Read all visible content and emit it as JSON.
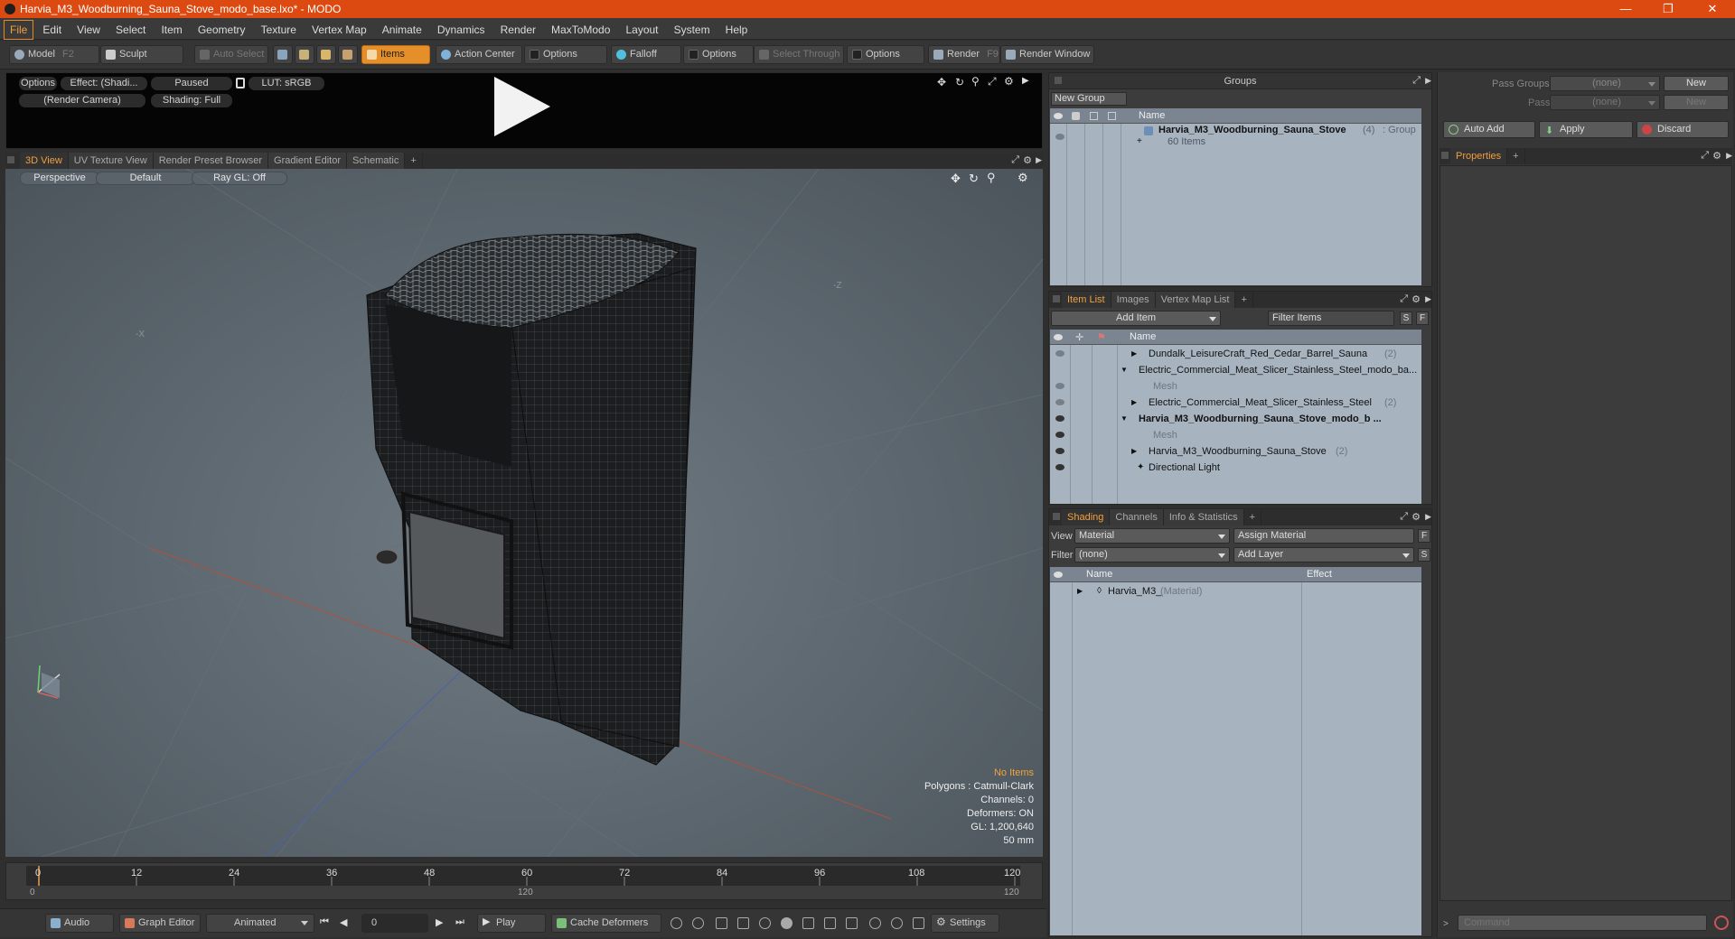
{
  "window": {
    "title": "Harvia_M3_Woodburning_Sauna_Stove_modo_base.lxo* - MODO",
    "minimize": "—",
    "restore": "❐",
    "close": "✕"
  },
  "menu": [
    "File",
    "Edit",
    "View",
    "Select",
    "Item",
    "Geometry",
    "Texture",
    "Vertex Map",
    "Animate",
    "Dynamics",
    "Render",
    "MaxToModo",
    "Layout",
    "System",
    "Help"
  ],
  "toolbar": {
    "model": "Model",
    "model_key": "F2",
    "sculpt": "Sculpt",
    "auto_select": "Auto Select",
    "items": "Items",
    "action_center": "Action Center",
    "options1": "Options",
    "falloff": "Falloff",
    "options2": "Options",
    "select_through": "Select Through",
    "options3": "Options",
    "render": "Render",
    "render_key": "F9",
    "render_window": "Render Window"
  },
  "preview": {
    "options": "Options",
    "effect": "Effect: (Shadi...",
    "paused": "Paused",
    "lut": "LUT: sRGB",
    "camera": "(Render Camera)",
    "shading": "Shading: Full"
  },
  "viewtabs": [
    "3D View",
    "UV Texture View",
    "Render Preset Browser",
    "Gradient Editor",
    "Schematic",
    "+"
  ],
  "viewport": {
    "projection": "Perspective",
    "style": "Default",
    "raygl": "Ray GL: Off",
    "axis_x": "-X",
    "axis_z": "-Z"
  },
  "stats": {
    "items": "No Items",
    "polygons": "Polygons : Catmull-Clark",
    "channels": "Channels: 0",
    "deformers": "Deformers: ON",
    "gl": "GL: 1,200,640",
    "focal": "50 mm"
  },
  "timeline": {
    "ticks": [
      "0",
      "12",
      "24",
      "36",
      "48",
      "60",
      "72",
      "84",
      "96",
      "108",
      "120"
    ],
    "sub_left": "0",
    "sub_mid": "120",
    "sub_right": "120"
  },
  "bottom": {
    "audio": "Audio",
    "graph_editor": "Graph Editor",
    "animated": "Animated",
    "frame": "0",
    "play": "Play",
    "cache": "Cache Deformers",
    "settings": "Settings"
  },
  "groups": {
    "header": "Groups",
    "new_group": "New Group",
    "col_name": "Name",
    "row_name": "Harvia_M3_Woodburning_Sauna_Stove",
    "row_count": "(4)",
    "row_type": ": Group",
    "row_items": "60 Items"
  },
  "passes": {
    "pass_groups": "Pass Groups",
    "passes": "Passes",
    "none1": "(none)",
    "none2": "(none)",
    "new1": "New",
    "new2": "New"
  },
  "actions": {
    "auto_add": "Auto Add",
    "apply": "Apply",
    "discard": "Discard"
  },
  "properties_tabs": [
    "Properties",
    "+"
  ],
  "itemlist": {
    "tabs": [
      "Item List",
      "Images",
      "Vertex Map List",
      "+"
    ],
    "add_item": "Add Item",
    "filter_placeholder": "Filter Items",
    "s": "S",
    "f": "F",
    "col_name": "Name",
    "rows": [
      {
        "name": "Dundalk_LeisureCraft_Red_Cedar_Barrel_Sauna",
        "suffix": "(2)"
      },
      {
        "name": "Electric_Commercial_Meat_Slicer_Stainless_Steel_modo_ba...",
        "suffix": ""
      },
      {
        "name": "Mesh",
        "suffix": ""
      },
      {
        "name": "Electric_Commercial_Meat_Slicer_Stainless_Steel",
        "suffix": "(2)"
      },
      {
        "name": "Harvia_M3_Woodburning_Sauna_Stove_modo_b ...",
        "suffix": ""
      },
      {
        "name": "Mesh",
        "suffix": ""
      },
      {
        "name": "Harvia_M3_Woodburning_Sauna_Stove",
        "suffix": "(2)"
      },
      {
        "name": "Directional Light",
        "suffix": ""
      }
    ]
  },
  "shading": {
    "tabs": [
      "Shading",
      "Channels",
      "Info & Statistics",
      "+"
    ],
    "view_label": "View",
    "view_value": "Material",
    "assign": "Assign Material",
    "f": "F",
    "filter_label": "Filter",
    "filter_value": "(none)",
    "add_layer": "Add Layer",
    "s": "S",
    "col_name": "Name",
    "col_effect": "Effect",
    "row_name": "Harvia_M3_",
    "row_type": "(Material)"
  },
  "command": {
    "placeholder": "Command"
  },
  "colors": {
    "accent": "#e58f2b",
    "titlebar": "#dc4a11"
  }
}
